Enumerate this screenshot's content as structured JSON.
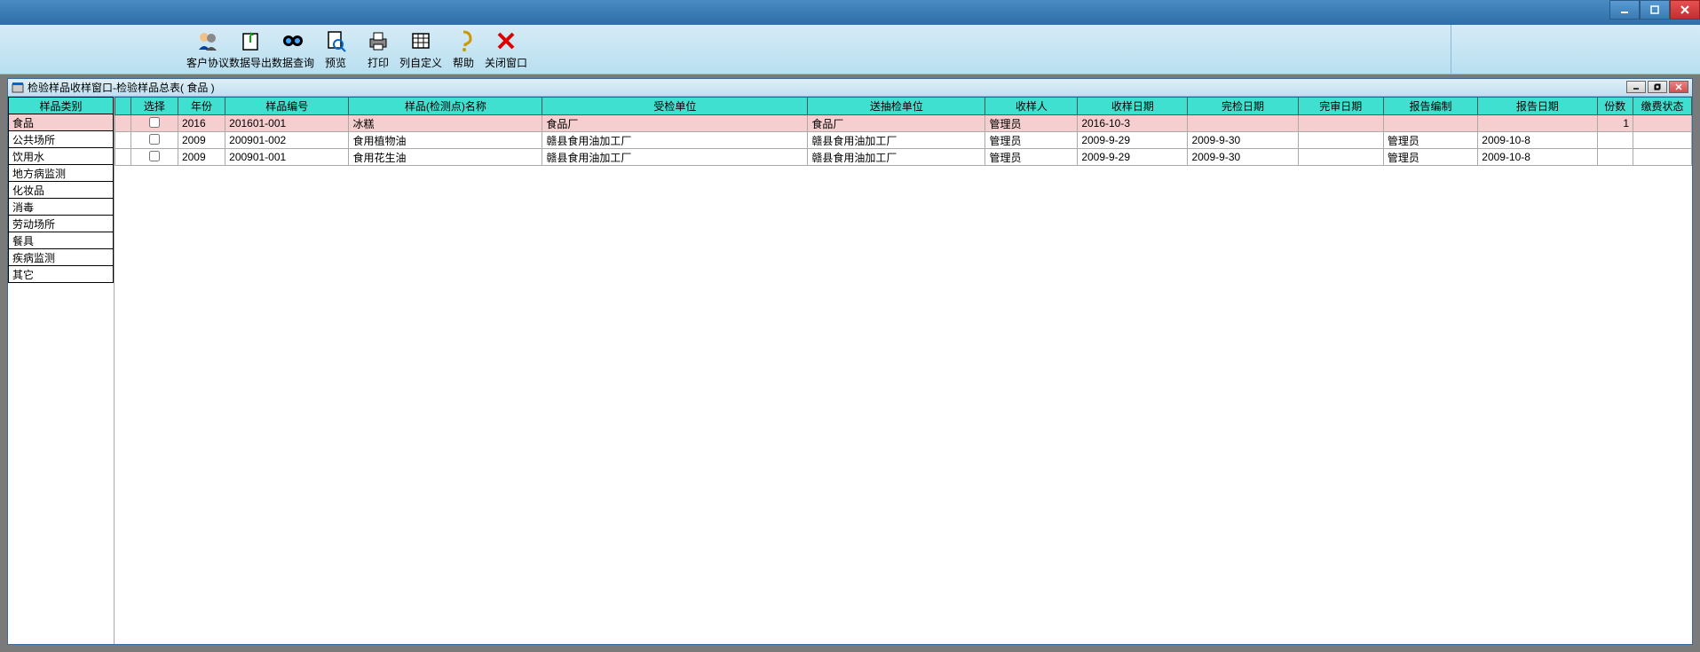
{
  "outer_window": {
    "title": ""
  },
  "toolbar": {
    "items": [
      {
        "label": "客户协议"
      },
      {
        "label": "数据导出"
      },
      {
        "label": "数据查询"
      },
      {
        "label": "预览"
      },
      {
        "label": "打印"
      },
      {
        "label": "列自定义"
      },
      {
        "label": "帮助"
      },
      {
        "label": "关闭窗口"
      }
    ]
  },
  "child_window": {
    "title": "检验样品收样窗口-检验样品总表( 食品 )"
  },
  "sidebar": {
    "header": "样品类别",
    "items": [
      "食品",
      "公共场所",
      "饮用水",
      "地方病监测",
      "化妆品",
      "消毒",
      "劳动场所",
      "餐具",
      "疾病监测",
      "其它"
    ],
    "selected_index": 0
  },
  "table": {
    "columns": [
      "选择",
      "年份",
      "样品编号",
      "样品(检测点)名称",
      "受检单位",
      "送抽检单位",
      "收样人",
      "收样日期",
      "完检日期",
      "完审日期",
      "报告编制",
      "报告日期",
      "份数",
      "缴费状态"
    ],
    "rows": [
      {
        "selected": true,
        "checked": false,
        "year": "2016",
        "code": "201601-001",
        "name": "冰糕",
        "insp": "食品厂",
        "send": "食品厂",
        "sampler": "管理员",
        "sdate": "2016-10-3",
        "fdate": "",
        "adate": "",
        "author": "",
        "rdate": "",
        "count": "1",
        "pay": ""
      },
      {
        "selected": false,
        "checked": false,
        "year": "2009",
        "code": "200901-002",
        "name": "食用植物油",
        "insp": "赣县食用油加工厂",
        "send": "赣县食用油加工厂",
        "sampler": "管理员",
        "sdate": "2009-9-29",
        "fdate": "2009-9-30",
        "adate": "",
        "author": "管理员",
        "rdate": "2009-10-8",
        "count": "",
        "pay": ""
      },
      {
        "selected": false,
        "checked": false,
        "year": "2009",
        "code": "200901-001",
        "name": "食用花生油",
        "insp": "赣县食用油加工厂",
        "send": "赣县食用油加工厂",
        "sampler": "管理员",
        "sdate": "2009-9-29",
        "fdate": "2009-9-30",
        "adate": "",
        "author": "管理员",
        "rdate": "2009-10-8",
        "count": "",
        "pay": ""
      }
    ]
  }
}
